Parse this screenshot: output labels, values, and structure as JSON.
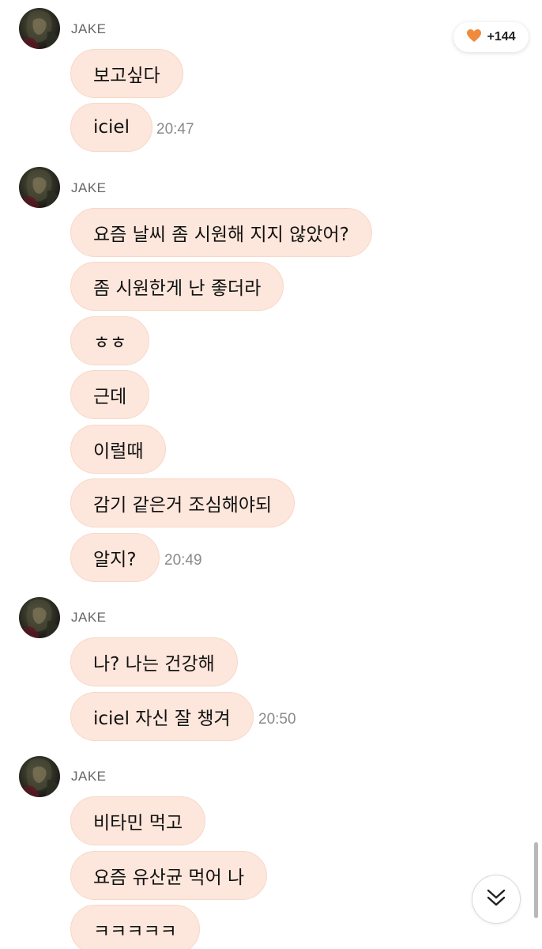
{
  "likes": {
    "count": "+144",
    "icon": "heart-icon",
    "color": "#f08a3c"
  },
  "scroll_to_bottom": {
    "icon": "double-chevron-down-icon"
  },
  "groups": [
    {
      "sender": "JAKE",
      "messages": [
        "보고싶다",
        "iciel"
      ],
      "time": "20:47"
    },
    {
      "sender": "JAKE",
      "messages": [
        "요즘 날씨 좀 시원해 지지 않았어?",
        "좀 시원한게 난 좋더라",
        "ㅎㅎ",
        "근데",
        "이럴때",
        "감기 같은거 조심해야되",
        "알지?"
      ],
      "time": "20:49"
    },
    {
      "sender": "JAKE",
      "messages": [
        "나? 나는 건강해",
        "iciel 자신 잘 챙겨"
      ],
      "time": "20:50"
    },
    {
      "sender": "JAKE",
      "messages": [
        "비타민 먹고",
        "요즘 유산균 먹어 나",
        "ㅋㅋㅋㅋㅋ"
      ]
    }
  ],
  "colors": {
    "bubble_bg": "#fde6db",
    "bubble_border": "#f7d8c8",
    "sender_text": "#666666",
    "time_text": "#8a8a8a"
  }
}
